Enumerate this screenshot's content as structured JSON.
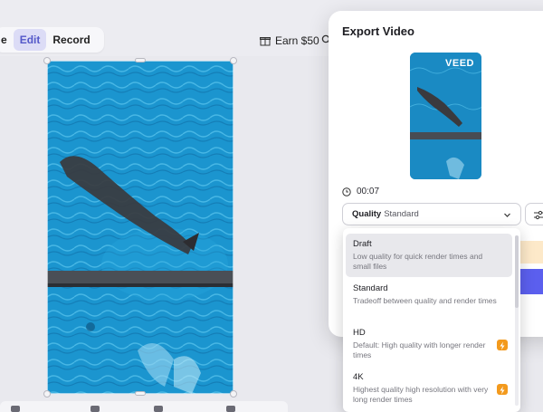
{
  "topbar": {
    "modes": [
      "e",
      "Edit",
      "Record"
    ],
    "active_mode": "Edit",
    "earn_label": "Earn $50"
  },
  "export_panel": {
    "title": "Export Video",
    "brand": "VEED",
    "duration": "00:07",
    "quality_label": "Quality",
    "quality_value": "Standard"
  },
  "quality_options": [
    {
      "name": "Draft",
      "description": "Low quality for quick render times and small files",
      "premium": false
    },
    {
      "name": "Standard",
      "description": "Tradeoff between quality and render times",
      "premium": false
    },
    {
      "name": "HD",
      "description": "Default: High quality with longer render times",
      "premium": true
    },
    {
      "name": "4K",
      "description": "Highest quality high resolution with very long render times",
      "premium": true
    }
  ],
  "colors": {
    "accent": "#5b5fee",
    "active_tab_bg": "#dcdcf6",
    "premium_badge": "#f39a1d"
  }
}
